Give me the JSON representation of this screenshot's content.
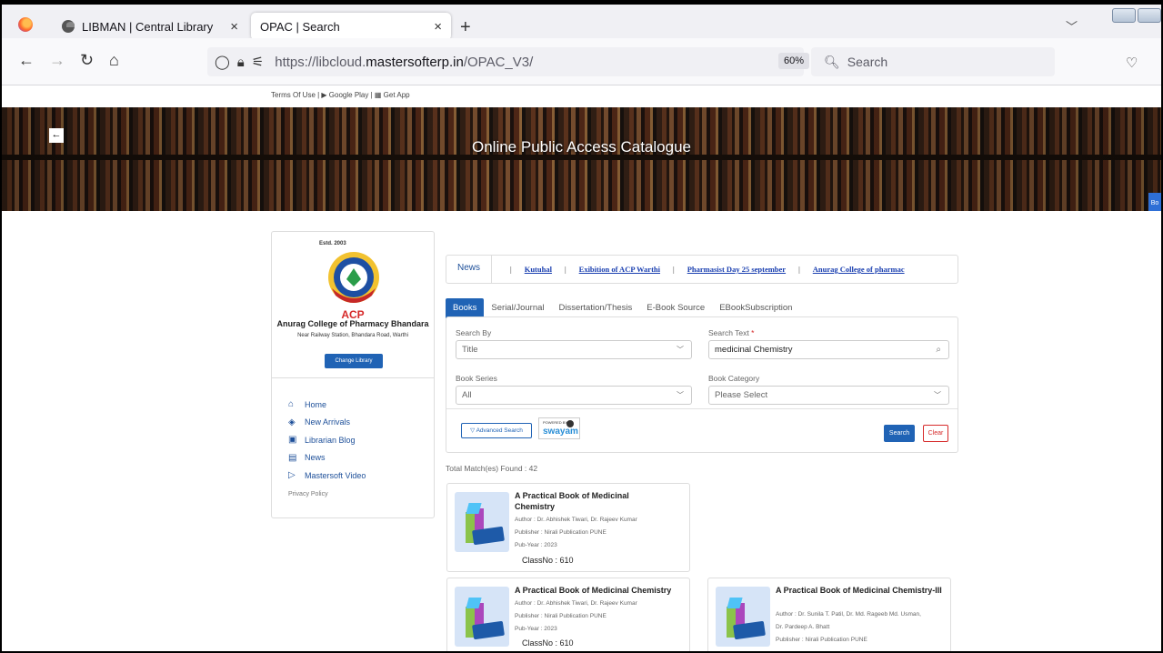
{
  "browser": {
    "tabs": [
      {
        "title": "LIBMAN | Central Library",
        "close": "×"
      },
      {
        "title": "OPAC | Search",
        "close": "×"
      }
    ],
    "new_tab": "+",
    "url_prefix": "https://libcloud.",
    "url_domain": "mastersofterp.in",
    "url_path": "/OPAC_V3/",
    "zoom": "60%",
    "search_placeholder": "Search"
  },
  "page": {
    "top_links": "Terms Of Use  |  ▶ Google Play  |  ▦ Get App",
    "hero_title": "Online Public Access Catalogue",
    "hero_side_tab": "Bo"
  },
  "library": {
    "estd": "Estd. 2003",
    "short_name": "ACP",
    "name": "Anurag College of Pharmacy Bhandara",
    "address": "Near Railway Station, Bhandara Road, Warthi",
    "change_button": "Change Library",
    "menu": [
      {
        "label": "Home",
        "icon": "home-icon"
      },
      {
        "label": "New Arrivals",
        "icon": "diamond-icon"
      },
      {
        "label": "Librarian Blog",
        "icon": "blog-icon"
      },
      {
        "label": "News",
        "icon": "news-icon"
      },
      {
        "label": "Mastersoft Video",
        "icon": "video-icon"
      }
    ],
    "privacy": "Privacy Policy"
  },
  "news": {
    "label": "News",
    "items": [
      "Kutuhal",
      "Exibition of ACP Warthi",
      "Pharmasist Day 25 september",
      "Anurag College of pharmac"
    ]
  },
  "search_tabs": [
    "Books",
    "Serial/Journal",
    "Dissertation/Thesis",
    "E-Book Source",
    "EBookSubscription"
  ],
  "form": {
    "search_by_label": "Search By",
    "search_by_value": "Title",
    "search_text_label": "Search Text",
    "search_text_value": "medicinal Chemistry",
    "book_series_label": "Book Series",
    "book_series_value": "All",
    "book_category_label": "Book Category",
    "book_category_value": "Please Select",
    "advanced_search": "Advanced Search",
    "swayam_powered": "POWERED BY",
    "swayam_word": "swayam",
    "search_button": "Search",
    "clear_button": "Clear"
  },
  "results": {
    "total": "Total Match(es) Found : 42",
    "items": [
      {
        "title": "A Practical Book of Medicinal Chemistry",
        "author": "Author : Dr. Abhishek Tiwari, Dr. Rajeev Kumar",
        "publisher": "Publisher : Nirali Publication PUNE",
        "year": "Pub-Year : 2023",
        "classno": "ClassNo : 610"
      },
      {
        "title": "A Practical Book of Medicinal Chemistry",
        "author": "Author : Dr. Abhishek Tiwari, Dr. Rajeev Kumar",
        "publisher": "Publisher : Nirali Publication PUNE",
        "year": "Pub-Year : 2023",
        "classno": "ClassNo : 610"
      },
      {
        "title": "A Practical Book of Medicinal Chemistry-III",
        "author": "Author : Dr. Sunila T. Patil, Dr. Md. Rageeb Md. Usman,",
        "author2": "Dr. Pardeep A. Bhatt",
        "publisher": "Publisher : Nirali Publication PUNE"
      }
    ]
  },
  "colors": {
    "primary": "#2063b5",
    "danger": "#d62a2a",
    "link": "#1a3fb0"
  }
}
